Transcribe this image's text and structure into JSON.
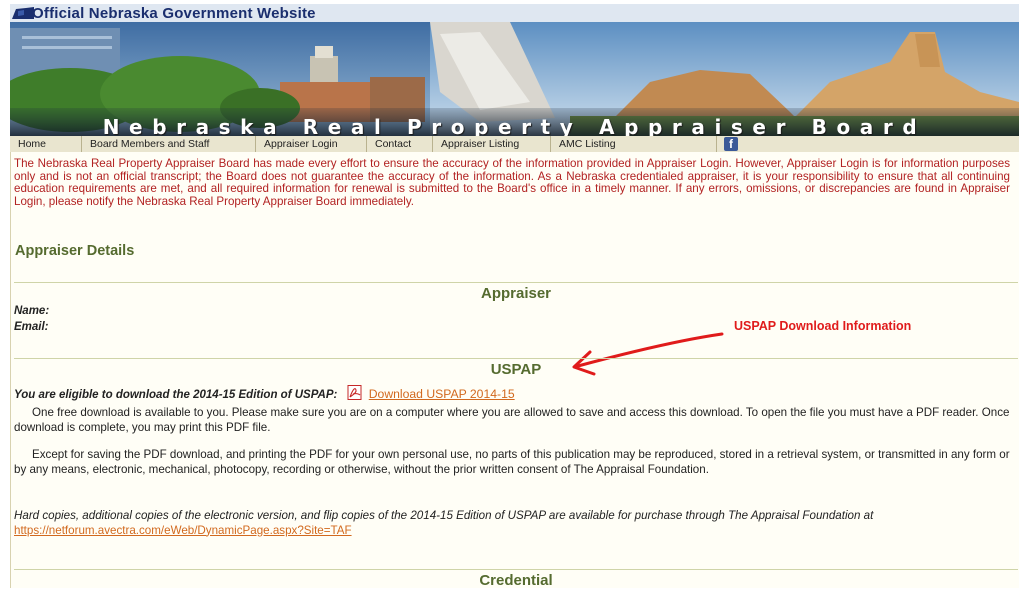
{
  "official_title": "Official Nebraska Government Website",
  "banner_title": "Nebraska Real Property Appraiser Board",
  "nav": {
    "items": [
      "Home",
      "Board Members and Staff",
      "Appraiser Login",
      "Contact",
      "Appraiser Listing",
      "AMC Listing"
    ],
    "facebook_icon": "f"
  },
  "disclaimer": "The Nebraska Real Property Appraiser Board has made every effort to ensure the accuracy of the information provided in Appraiser Login. However, Appraiser Login is for information purposes only and is not an official transcript; the Board does not guarantee the accuracy of the information. As a Nebraska credentialed appraiser, it is your responsibility to ensure that all continuing education requirements are met, and all required information for renewal is submitted to the Board's office in a timely manner. If any errors, omissions, or discrepancies are found in Appraiser Login, please notify the Nebraska Real Property Appraiser Board immediately.",
  "page_heading": "Appraiser Details",
  "appraiser_section": {
    "title": "Appraiser",
    "name_label": "Name:",
    "email_label": "Email:"
  },
  "annotation": "USPAP Download Information",
  "uspap_section": {
    "title": "USPAP",
    "eligible_label": "You are eligible to download the 2014-15 Edition of USPAP:",
    "download_link": "Download USPAP 2014-15",
    "para1": "One free download is available to you. Please make sure you are on a computer where you are allowed to save and access this download. To open the file you must have a PDF reader. Once download is complete, you may print this PDF file.",
    "para2": "Except for saving the PDF download, and printing the PDF for your own personal use, no parts of this publication may be reproduced, stored in a retrieval system, or transmitted in any form or by any means, electronic, mechanical, photocopy, recording or otherwise, without the prior written consent of The Appraisal Foundation.",
    "para3_text": "Hard copies, additional copies of the electronic version, and flip copies of the 2014-15 Edition of USPAP are available for purchase through The Appraisal Foundation at ",
    "para3_link": "https://netforum.avectra.com/eWeb/DynamicPage.aspx?Site=TAF"
  },
  "credential_section": {
    "title": "Credential"
  },
  "colors": {
    "heading_green": "#556b2f",
    "disclaimer_red": "#b22222",
    "link_orange": "#d2691e",
    "annotation_red": "#e01b1b",
    "nav_bg": "#e9e5cf"
  }
}
